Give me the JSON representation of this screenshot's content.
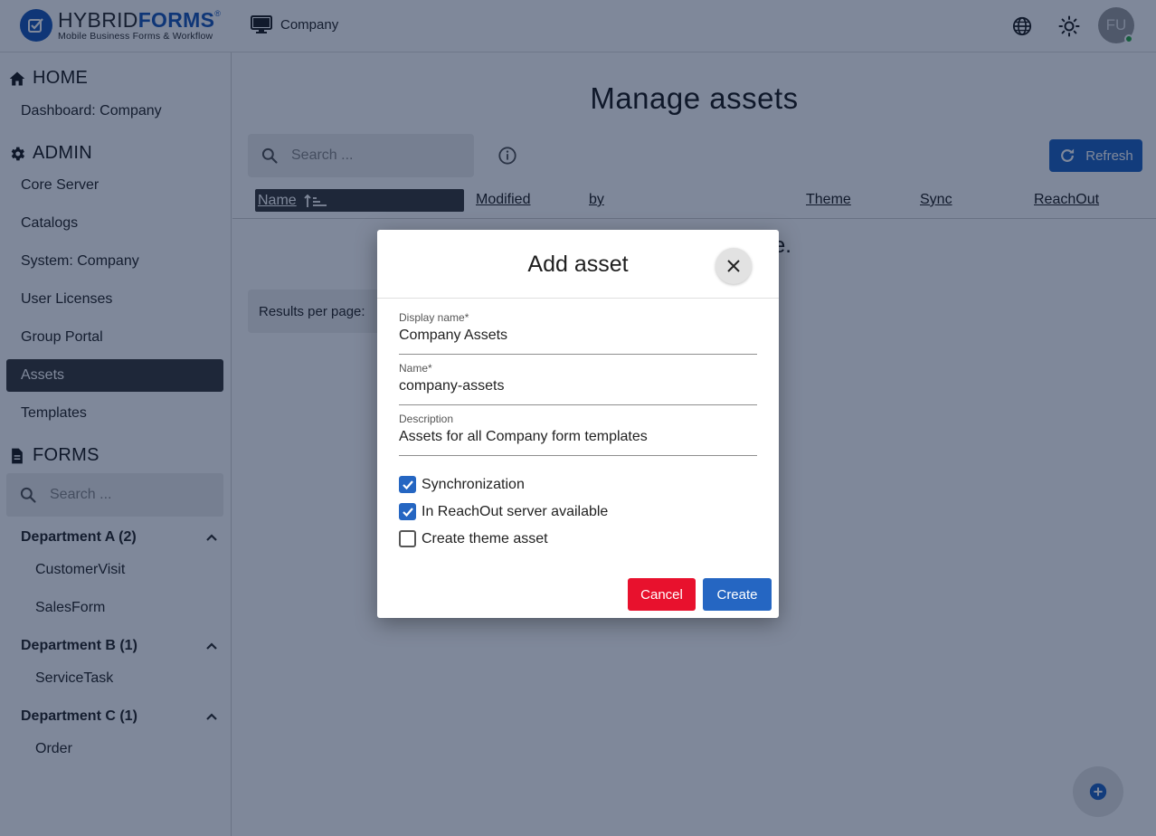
{
  "header": {
    "logo_hybrid": "HYBRID",
    "logo_forms": "FORMS",
    "logo_reg": "®",
    "logo_tagline": "Mobile Business Forms & Workflow",
    "company": "Company",
    "avatar_initials": "FU"
  },
  "sidebar": {
    "home": {
      "title": "HOME",
      "items": [
        {
          "label": "Dashboard: Company"
        }
      ]
    },
    "admin": {
      "title": "ADMIN",
      "items": [
        {
          "label": "Core Server"
        },
        {
          "label": "Catalogs"
        },
        {
          "label": "System: Company"
        },
        {
          "label": "User Licenses"
        },
        {
          "label": "Group Portal"
        },
        {
          "label": "Assets",
          "active": true
        },
        {
          "label": "Templates"
        }
      ]
    },
    "forms": {
      "title": "FORMS",
      "search_placeholder": "Search ...",
      "departments": [
        {
          "label": "Department A (2)",
          "forms": [
            "CustomerVisit",
            "SalesForm"
          ]
        },
        {
          "label": "Department B (1)",
          "forms": [
            "ServiceTask"
          ]
        },
        {
          "label": "Department C (1)",
          "forms": [
            "Order"
          ]
        }
      ]
    }
  },
  "main": {
    "title": "Manage assets",
    "search_placeholder": "Search ...",
    "refresh_label": "Refresh",
    "columns": [
      "Name",
      "Modified",
      "by",
      "Theme",
      "Sync",
      "ReachOut"
    ],
    "empty_text": "No assets available.",
    "results_label": "Results per page:"
  },
  "dialog": {
    "title": "Add asset",
    "fields": [
      {
        "label": "Display name",
        "required": "*",
        "value": "Company Assets"
      },
      {
        "label": "Name",
        "required": "*",
        "value": "company-assets"
      },
      {
        "label": "Description",
        "required": "",
        "value": "Assets for all Company form templates"
      }
    ],
    "checkboxes": [
      {
        "label": "Synchronization",
        "checked": true
      },
      {
        "label": "In ReachOut server available",
        "checked": true
      },
      {
        "label": "Create theme asset",
        "checked": false
      }
    ],
    "cancel_label": "Cancel",
    "create_label": "Create"
  },
  "colors": {
    "accent": "#2566c2",
    "danger": "#e8112d",
    "active_nav": "#3d3d3d",
    "online": "#2eaa44"
  }
}
